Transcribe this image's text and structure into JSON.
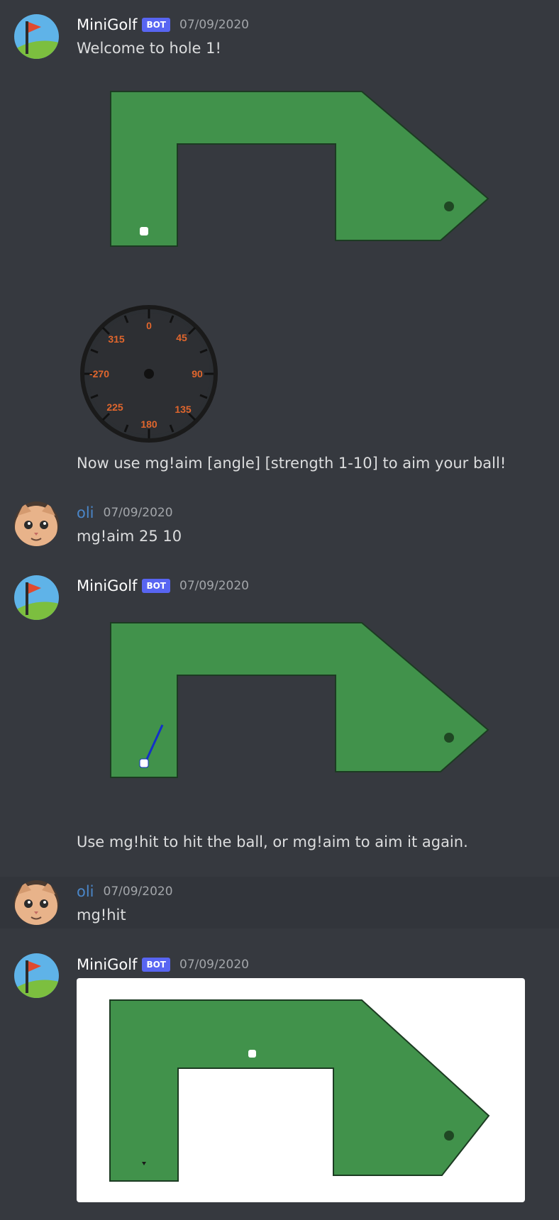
{
  "messages": [
    {
      "username": "MiniGolf",
      "bot_tag": "BOT",
      "timestamp": "07/09/2020",
      "text": "Welcome to hole 1!",
      "followup": "Now use mg!aim [angle] [strength 1-10] to aim your ball!",
      "compass_labels": [
        "0",
        "45",
        "90",
        "135",
        "180",
        "225",
        "-270",
        "315"
      ]
    },
    {
      "username": "oli",
      "timestamp": "07/09/2020",
      "text": "mg!aim 25 10"
    },
    {
      "username": "MiniGolf",
      "bot_tag": "BOT",
      "timestamp": "07/09/2020",
      "text": "Use mg!hit to hit the ball, or mg!aim to aim it again."
    },
    {
      "username": "oli",
      "timestamp": "07/09/2020",
      "text": "mg!hit"
    },
    {
      "username": "MiniGolf",
      "bot_tag": "BOT",
      "timestamp": "07/09/2020"
    }
  ],
  "colors": {
    "background": "#36393f",
    "course_green": "#41924b",
    "bot_tag": "#5865f2",
    "user_name": "#4a86c8",
    "compass_label": "#e0662d"
  },
  "icons": {
    "bot_avatar": "golf-flag-icon",
    "user_avatar": "cat-face-avatar"
  }
}
